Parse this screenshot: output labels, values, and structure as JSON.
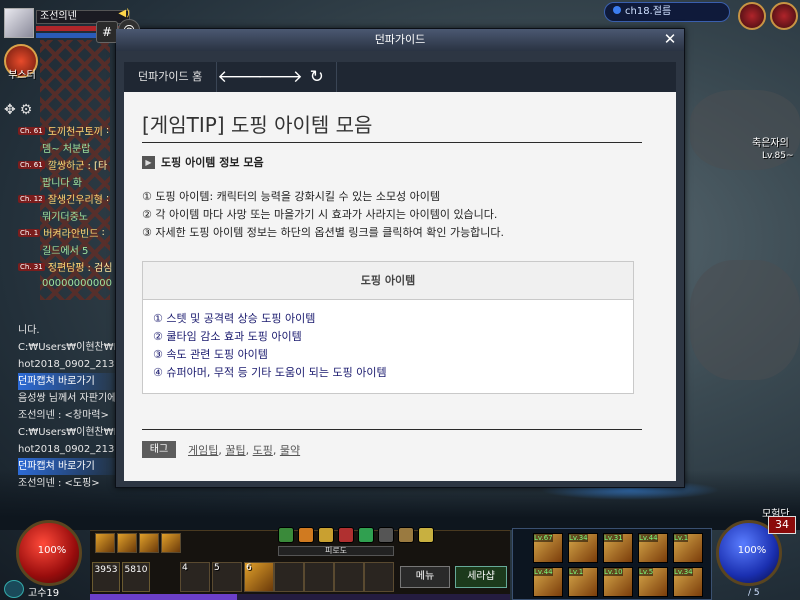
{
  "player": {
    "name": "조선의넨",
    "booster_label": "부스터",
    "level_label": "고수19"
  },
  "chat": [
    {
      "channel": "Ch. 61",
      "name": "도끼천구토끼",
      "text": ":"
    },
    {
      "channel": "",
      "name": "",
      "text": "뎀~ 처분랍"
    },
    {
      "channel": "Ch. 61",
      "name": "깔쌍하군",
      "text": ": [타"
    },
    {
      "channel": "",
      "name": "",
      "text": "팝니다 화"
    },
    {
      "channel": "Ch. 12",
      "name": "잘생긴우리형",
      "text": ":"
    },
    {
      "channel": "",
      "name": "",
      "text": "뭐기더중노"
    },
    {
      "channel": "Ch. 1",
      "name": "버켜라안빈드",
      "text": ":"
    },
    {
      "channel": "",
      "name": "",
      "text": "길드에서 5"
    },
    {
      "channel": "Ch. 31",
      "name": "정편담펑",
      "text": ": 검심"
    },
    {
      "channel": "",
      "name": "",
      "text": "00000000000"
    }
  ],
  "syslog": [
    {
      "text": "니다.",
      "capture": false
    },
    {
      "text": "C:₩Users₩이현찬₩Doc",
      "capture": false
    },
    {
      "text": "hot2018_0902_213048",
      "capture": false
    },
    {
      "text": "던파캡쳐 바로가기",
      "capture": true
    },
    {
      "text": "음성쌍 님께서 자판기에",
      "capture": false
    },
    {
      "text": "조선의넨 : <창마력>",
      "capture": false
    },
    {
      "text": "C:₩Users₩이현찬₩Doc",
      "capture": false
    },
    {
      "text": "hot2018_0902_213058",
      "capture": false
    },
    {
      "text": "던파캡쳐 바로가기",
      "capture": true
    },
    {
      "text": "조선의넨 : <도핑>",
      "capture": false
    }
  ],
  "channel": {
    "label": "ch18.절름"
  },
  "minimap": {
    "label": "축은자의",
    "level": "Lv.85~"
  },
  "window": {
    "title": "던파가이드",
    "home_label": "던파가이드 홈",
    "back_icon": "arrow-left",
    "forward_icon": "arrow-right",
    "refresh_icon": "refresh",
    "page_title": "[게임TIP] 도핑 아이템 모음",
    "section_title": "도핑 아이템 정보 모음",
    "intro": [
      "① 도핑 아이템: 캐릭터의 능력을 강화시킬 수 있는 소모성 아이템",
      "② 각 아이템 마다 사망 또는 마을가기 시 효과가 사라지는 아이템이 있습니다.",
      "③ 자세한 도핑 아이템 정보는 하단의 옵션별 링크를 클릭하여 확인 가능합니다."
    ],
    "box_title": "도핑 아이템",
    "links": [
      "① 스텟 및 공격력 상승 도핑 아이템",
      "② 쿨타임 감소 효과 도핑 아이템",
      "③ 속도 관련 도핑 아이템",
      "④ 슈퍼아머, 무적 등 기타 도움이 되는 도핑 아이템"
    ],
    "tag_label": "태그",
    "tags": [
      "게임팁",
      "꿀팁",
      "도핑",
      "물약"
    ]
  },
  "hud": {
    "hp_text": "100%",
    "mp_text": "100%",
    "fatigue_label": "피로도",
    "menu_label": "메뉴",
    "seria_label": "세라샵",
    "adventure_label": "모험단",
    "adventure_level": "34",
    "mp_fraction": "/ 5",
    "stat1": "3953",
    "stat2": "5810",
    "exp_fraction": 0.35,
    "skill_levels": [
      "Lv.67",
      "Lv.34",
      "Lv.31",
      "Lv.44",
      "Lv.1",
      "Lv.44",
      "Lv.1",
      "Lv.10",
      "Lv.5",
      "Lv.34"
    ]
  },
  "colors": {
    "accent": "#3c7df0",
    "hp": "#b0262a",
    "mp": "#2a5bb8",
    "link": "#1a1a6e"
  }
}
